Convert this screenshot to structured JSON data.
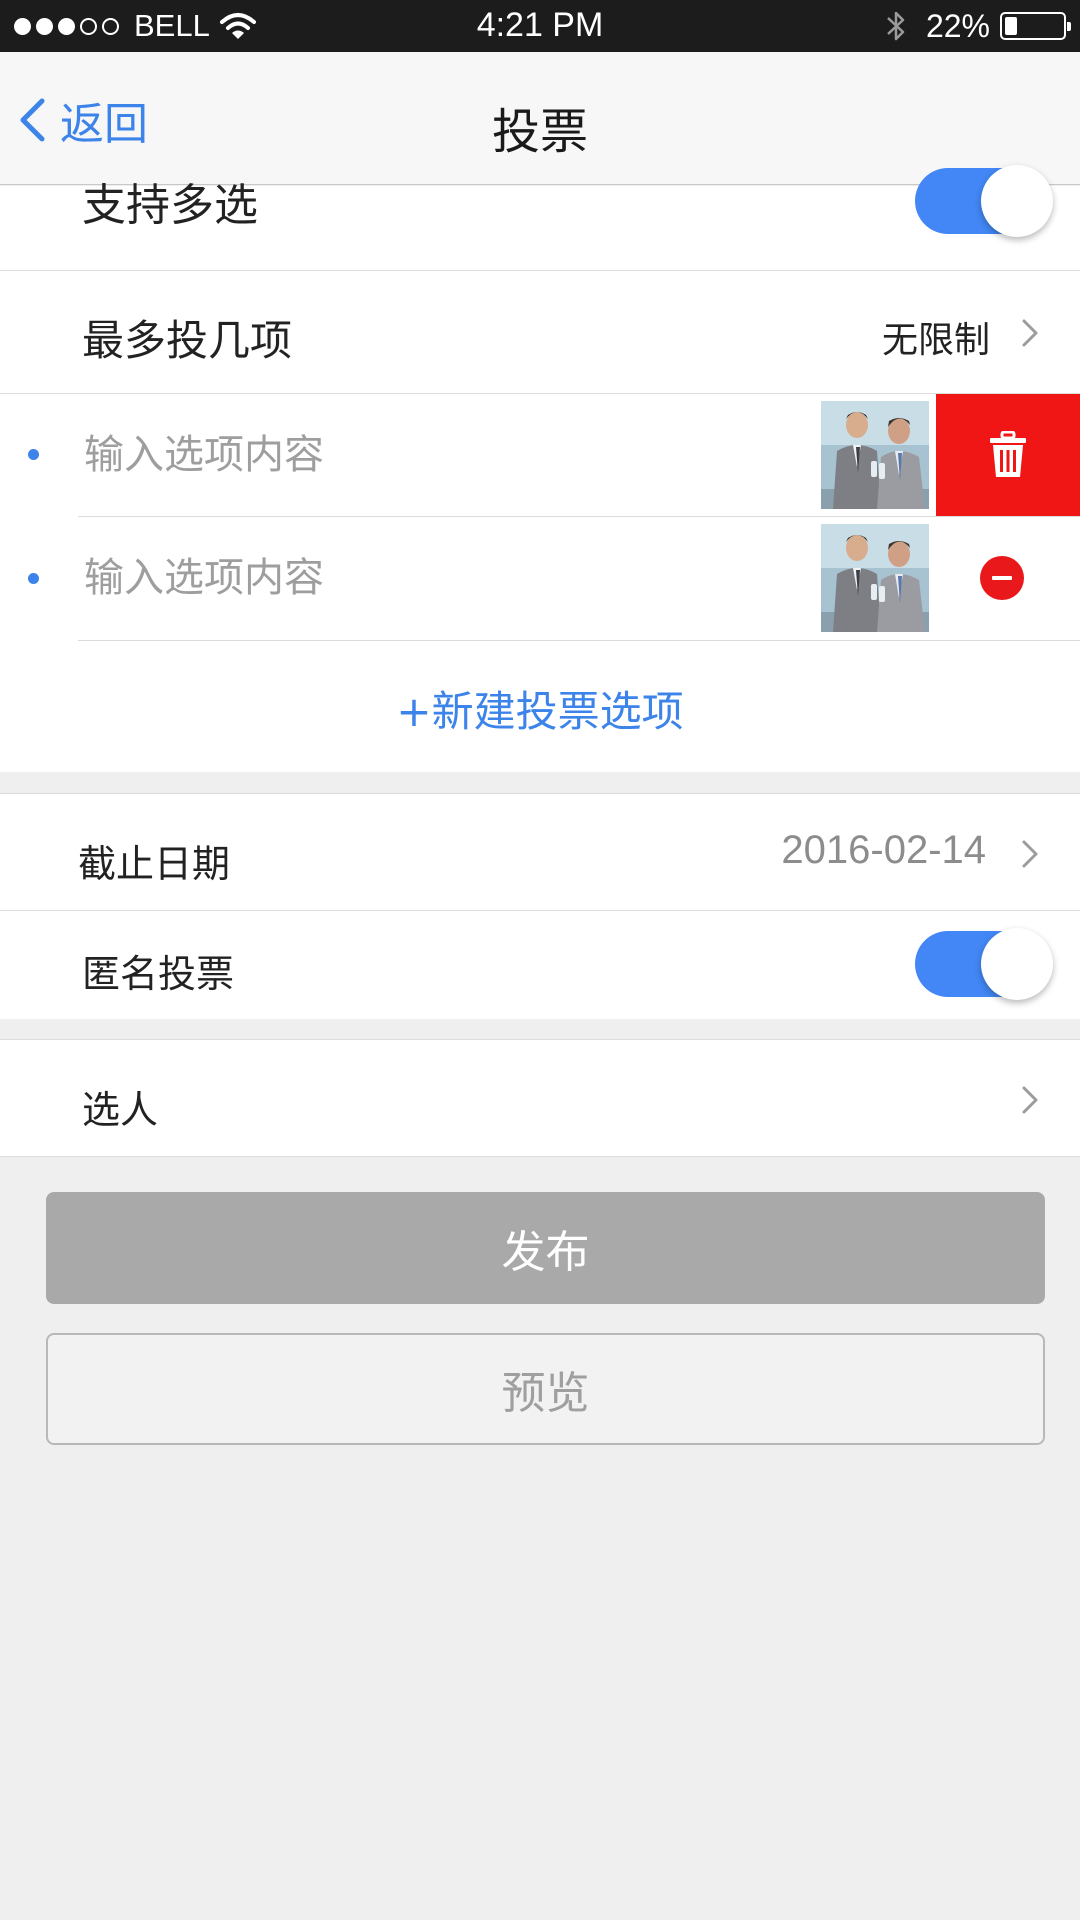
{
  "status_bar": {
    "carrier": "BELL",
    "time": "4:21 PM",
    "battery": "22%",
    "battery_level": 0.22,
    "signal_bars_filled": 3,
    "signal_bars_total": 5,
    "icons": [
      "wifi-icon",
      "bluetooth-icon",
      "battery-icon"
    ]
  },
  "nav": {
    "back_label": "返回",
    "title": "投票"
  },
  "settings": {
    "multi_select_label": "支持多选",
    "multi_select_on": true,
    "max_votes_label": "最多投几项",
    "max_votes_value": "无限制"
  },
  "options": [
    {
      "placeholder": "输入选项内容",
      "value": "",
      "action": "delete",
      "action_icon": "trash-icon"
    },
    {
      "placeholder": "输入选项内容",
      "value": "",
      "action": "remove",
      "action_icon": "minus-circle-icon"
    }
  ],
  "add_option_label": "+新建投票选项",
  "deadline": {
    "label": "截止日期",
    "value": "2016-02-14"
  },
  "anonymous": {
    "label": "匿名投票",
    "on": true
  },
  "select_people": {
    "label": "选人"
  },
  "buttons": {
    "publish": "发布",
    "preview": "预览"
  },
  "colors": {
    "accent": "#3c83ea",
    "toggle_on": "#4287f5",
    "delete_red": "#f01616",
    "publish_bg": "#a9a9a9",
    "page_bg": "#efeff0"
  }
}
